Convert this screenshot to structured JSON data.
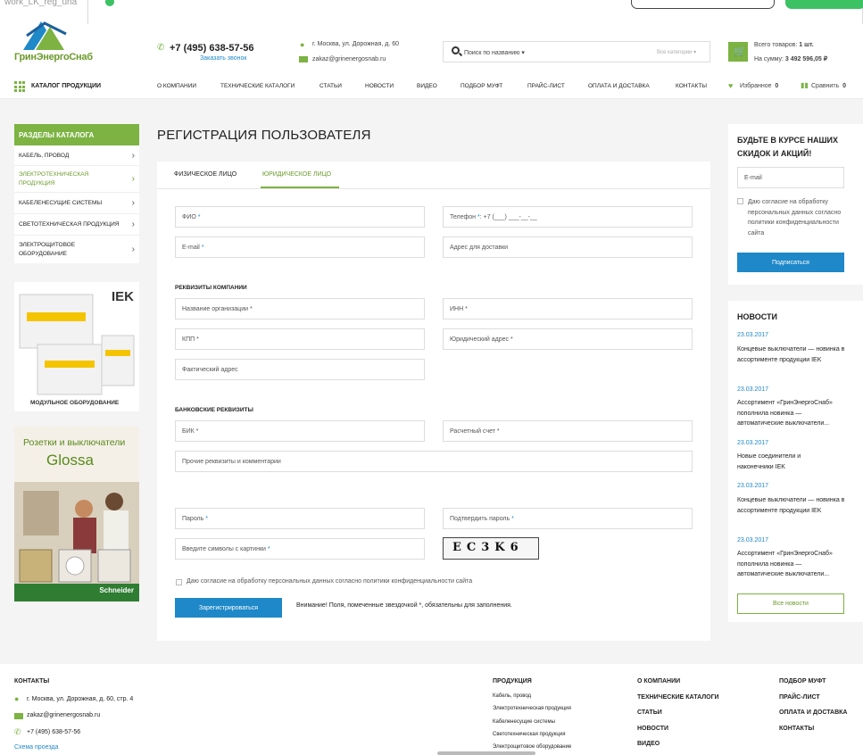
{
  "browser": {
    "tab_text": "work_LK_reg_una"
  },
  "header": {
    "logo_text": "ГринЭнергоСнаб",
    "phone": "+7 (495) 638-57-56",
    "callback": "Заказать звонок",
    "address": "г. Москва, ул. Дорожная, д. 60",
    "email": "zakaz@grinenergosnab.ru",
    "search_placeholder": "Поиск по названию",
    "search_category": "Все категории",
    "cart_total_label": "Всего товаров:",
    "cart_total_value": "1 шт.",
    "cart_sum_label": "На сумму:",
    "cart_sum_value": "3 492 596,05"
  },
  "nav": {
    "catalog": "КАТАЛОГ ПРОДУКЦИИ",
    "items": [
      "О КОМПАНИИ",
      "ТЕХНИЧЕСКИЕ КАТАЛОГИ",
      "СТАТЬИ",
      "НОВОСТИ",
      "ВИДЕО",
      "ПОДБОР МУФТ",
      "ПРАЙС-ЛИСТ",
      "ОПЛАТА И ДОСТАВКА",
      "КОНТАКТЫ"
    ],
    "favorites": "Избранное",
    "favorites_count": "0",
    "compare": "Сравнить",
    "compare_count": "0"
  },
  "sidebar": {
    "title": "РАЗДЕЛЫ КАТАЛОГА",
    "items": [
      {
        "label": "КАБЕЛЬ, ПРОВОД"
      },
      {
        "label": "ЭЛЕКТРОТЕХНИЧЕСКАЯ ПРОДУКЦИЯ"
      },
      {
        "label": "КАБЕЛЕНЕСУЩИЕ СИСТЕМЫ"
      },
      {
        "label": "СВЕТОТЕХНИЧЕСКАЯ ПРОДУКЦИЯ"
      },
      {
        "label": "ЭЛЕКТРОЩИТОВОЕ ОБОРУДОВАНИЕ"
      }
    ],
    "banner1_caption": "МОДУЛЬНОЕ ОБОРУДОВАНИЕ",
    "banner1_brand": "IEK",
    "banner2_line1": "Розетки и выключатели",
    "banner2_line2": "Glossa",
    "banner2_brand": "Schneider"
  },
  "page": {
    "title": "РЕГИСТРАЦИЯ ПОЛЬЗОВАТЕЛЯ"
  },
  "form": {
    "tabs": [
      "ФИЗИЧЕСКОЕ ЛИЦО",
      "ЮРИДИЧЕСКОЕ ЛИЦО"
    ],
    "fio": "ФИО",
    "phone": "Телефон",
    "phone_mask": ": +7 (___) ___-__-__",
    "email": "E-mail",
    "delivery": "Адрес для доставки",
    "company_section": "РЕКВИЗИТЫ КОМПАНИИ",
    "org_name": "Название организации",
    "inn": "ИНН",
    "kpp": "КПП",
    "legal_address": "Юридический адрес",
    "actual_address": "Фактический адрес",
    "bank_section": "БАНКОВСКИЕ РЕКВИЗИТЫ",
    "bik": "БИК",
    "account": "Расчетный счет",
    "other": "Прочие реквизиты и комментарии",
    "password": "Пароль",
    "password_confirm": "Подтвердить пароль",
    "captcha_input": "Введите символы с картинки",
    "captcha_text": "EC3K6",
    "required_mark": "*",
    "agree": "Даю согласие на обработку персональных данных согласно политики конфиденциальности сайта",
    "submit": "Зарегистрироваться",
    "warning": "Внимание! Поля, помеченные звездочкой *, обязательны для заполнения."
  },
  "subscribe": {
    "title": "БУДЬТЕ В КУРСЕ НАШИХ СКИДОК И АКЦИЙ!",
    "email_placeholder": "E-mail",
    "agree": "Даю согласие на обработку персональных данных согласно политики конфиденциальности сайта",
    "button": "Подписаться"
  },
  "news": {
    "title": "НОВОСТИ",
    "items": [
      {
        "date": "23.03.2017",
        "text": "Концевые выключатели — новинка в ассортименте продукции IEK"
      },
      {
        "date": "23.03.2017",
        "text": "Ассортимент «ГринЭнергоСнаб» пополнила новинка — автоматические выключатели..."
      },
      {
        "date": "23.03.2017",
        "text": "Новые соединители и наконечники IEK"
      },
      {
        "date": "23.03.2017",
        "text": "Концевые выключатели — новинка в ассортименте продукции IEK"
      },
      {
        "date": "23.03.2017",
        "text": "Ассортимент «ГринЭнергоСнаб» пополнила новинка — автоматические выключатели..."
      }
    ],
    "all": "Все новости"
  },
  "footer": {
    "contacts_title": "КОНТАКТЫ",
    "address": "г. Москва, ул. Дорожная, д. 60, стр. 4",
    "email": "zakaz@grinenergosnab.ru",
    "phone": "+7 (495) 638-57-56",
    "map_link": "Схема проезда",
    "products_title": "ПРОДУКЦИЯ",
    "products": [
      "Кабель, провод",
      "Электротехническая продукция",
      "Кабеленесущие системы",
      "Светотехническая продукция",
      "Электрощитовое оборудование"
    ],
    "col2": [
      "О КОМПАНИИ",
      "ТЕХНИЧЕСКИЕ КАТАЛОГИ",
      "СТАТЬИ",
      "НОВОСТИ",
      "ВИДЕО"
    ],
    "col3": [
      "ПОДБОР МУФТ",
      "ПРАЙС-ЛИСТ",
      "ОПЛАТА И ДОСТАВКА",
      "КОНТАКТЫ"
    ]
  },
  "colors": {
    "accent_green": "#7cb342",
    "link_blue": "#1e88c8"
  }
}
